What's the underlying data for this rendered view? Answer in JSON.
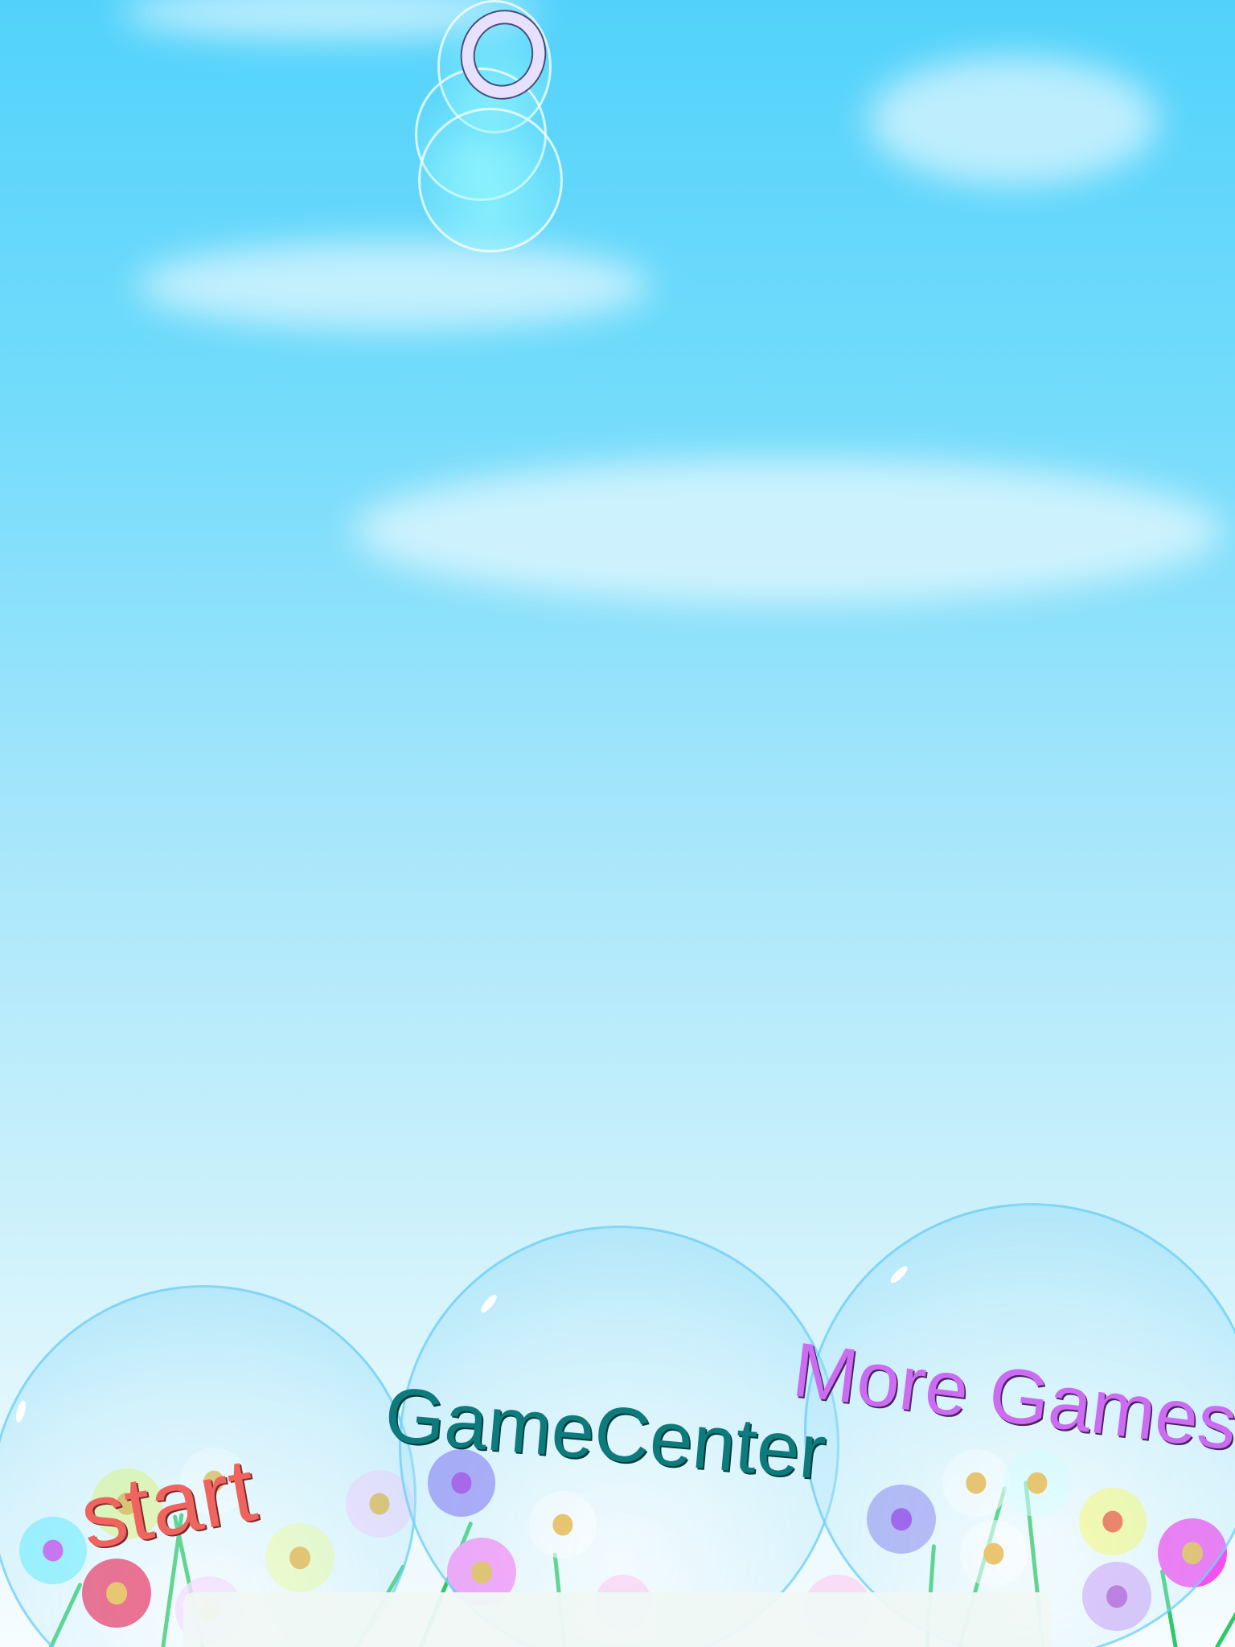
{
  "menu": {
    "start_label": "start",
    "gamecenter_label": "GameCenter",
    "more_games_label": "More Games"
  },
  "colors": {
    "sky_top": "#52d2fb",
    "sky_bottom": "#f6fcff",
    "start_text": "#f0645f",
    "gamecenter_text": "#0d7b7c",
    "more_games_text": "#cc6cf2",
    "grass": "#2ec96a"
  }
}
